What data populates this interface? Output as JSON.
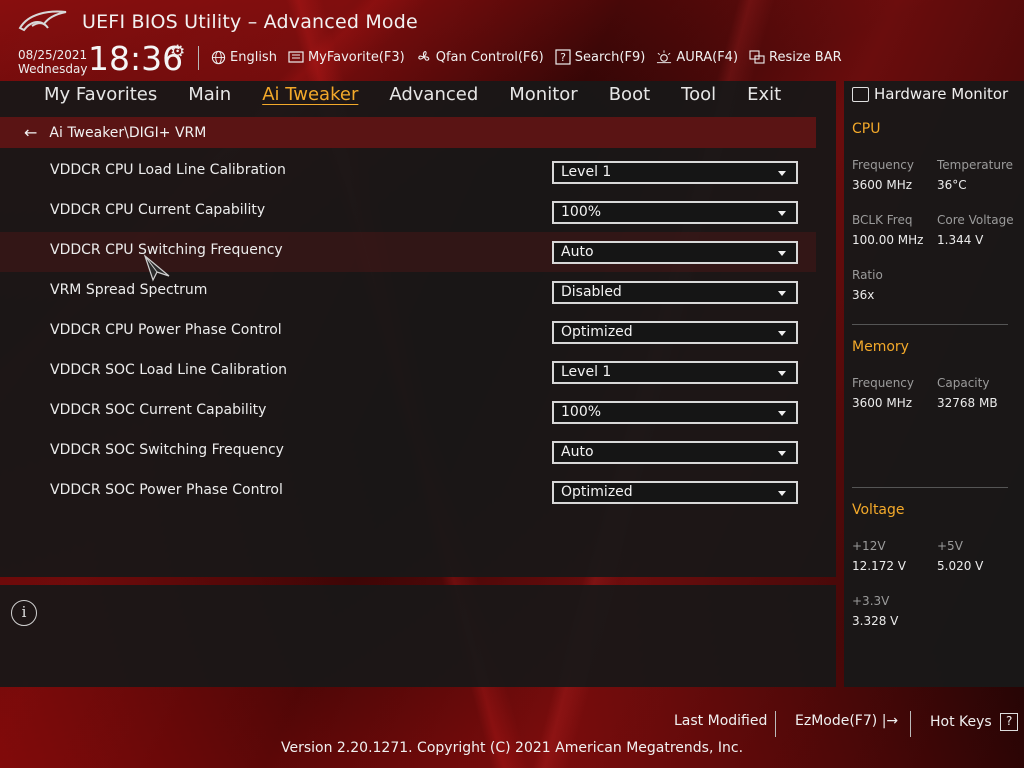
{
  "header": {
    "title": "UEFI BIOS Utility – Advanced Mode",
    "date": "08/25/2021",
    "weekday": "Wednesday",
    "time": "18:36"
  },
  "toolbar": {
    "items": [
      {
        "label": "English",
        "icon": "globe-icon"
      },
      {
        "label": "MyFavorite(F3)",
        "icon": "favorite-icon"
      },
      {
        "label": "Qfan Control(F6)",
        "icon": "fan-icon"
      },
      {
        "label": "Search(F9)",
        "icon": "search-icon"
      },
      {
        "label": "AURA(F4)",
        "icon": "aura-icon"
      },
      {
        "label": "Resize BAR",
        "icon": "resize-bar-icon"
      }
    ]
  },
  "nav": {
    "items": [
      "My Favorites",
      "Main",
      "Ai Tweaker",
      "Advanced",
      "Monitor",
      "Boot",
      "Tool",
      "Exit"
    ],
    "active": "Ai Tweaker"
  },
  "breadcrumb": "Ai Tweaker\\DIGI+ VRM",
  "settings": [
    {
      "label": "VDDCR CPU Load Line Calibration",
      "value": "Level 1"
    },
    {
      "label": "VDDCR CPU Current Capability",
      "value": "100%"
    },
    {
      "label": "VDDCR CPU Switching Frequency",
      "value": "Auto"
    },
    {
      "label": "VRM Spread Spectrum",
      "value": "Disabled"
    },
    {
      "label": "VDDCR CPU Power Phase Control",
      "value": "Optimized"
    },
    {
      "label": "VDDCR SOC Load Line Calibration",
      "value": "Level 1"
    },
    {
      "label": "VDDCR SOC Current Capability",
      "value": "100%"
    },
    {
      "label": "VDDCR SOC Switching Frequency",
      "value": "Auto"
    },
    {
      "label": "VDDCR SOC Power Phase Control",
      "value": "Optimized"
    }
  ],
  "hardware_monitor": {
    "title": "Hardware Monitor",
    "cpu": {
      "heading": "CPU",
      "frequency_label": "Frequency",
      "frequency": "3600 MHz",
      "temperature_label": "Temperature",
      "temperature": "36°C",
      "bclk_label": "BCLK Freq",
      "bclk": "100.00 MHz",
      "core_voltage_label": "Core Voltage",
      "core_voltage": "1.344 V",
      "ratio_label": "Ratio",
      "ratio": "36x"
    },
    "memory": {
      "heading": "Memory",
      "frequency_label": "Frequency",
      "frequency": "3600 MHz",
      "capacity_label": "Capacity",
      "capacity": "32768 MB"
    },
    "voltage": {
      "heading": "Voltage",
      "v12_label": "+12V",
      "v12": "12.172 V",
      "v5_label": "+5V",
      "v5": "5.020 V",
      "v33_label": "+3.3V",
      "v33": "3.328 V"
    }
  },
  "footer": {
    "last_modified": "Last Modified",
    "ezmode": "EzMode(F7)",
    "hotkeys": "Hot Keys",
    "hotkeys_key": "?",
    "version": "Version 2.20.1271. Copyright (C) 2021 American Megatrends, Inc."
  },
  "colors": {
    "accent": "#f3a92a",
    "breadcrumb_bg": "#5a1414"
  }
}
